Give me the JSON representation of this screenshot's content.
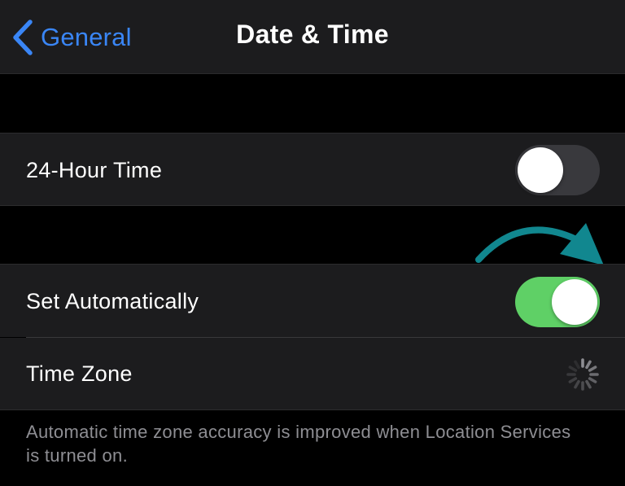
{
  "nav": {
    "back_label": "General",
    "title": "Date & Time"
  },
  "rows": {
    "hour24": {
      "label": "24-Hour Time",
      "on": false
    },
    "set_automatically": {
      "label": "Set Automatically",
      "on": true
    },
    "time_zone": {
      "label": "Time Zone",
      "loading_icon": "spinner-icon"
    }
  },
  "footer": {
    "note": "Automatic time zone accuracy is improved when Location Services is turned on."
  },
  "annotation": {
    "icon": "curved-arrow-icon",
    "color": "#11878f"
  },
  "colors": {
    "accent": "#3a86f6",
    "switch_on": "#5fd066",
    "switch_off": "#39393d",
    "cell_bg": "#1c1c1e",
    "page_bg": "#000000"
  }
}
